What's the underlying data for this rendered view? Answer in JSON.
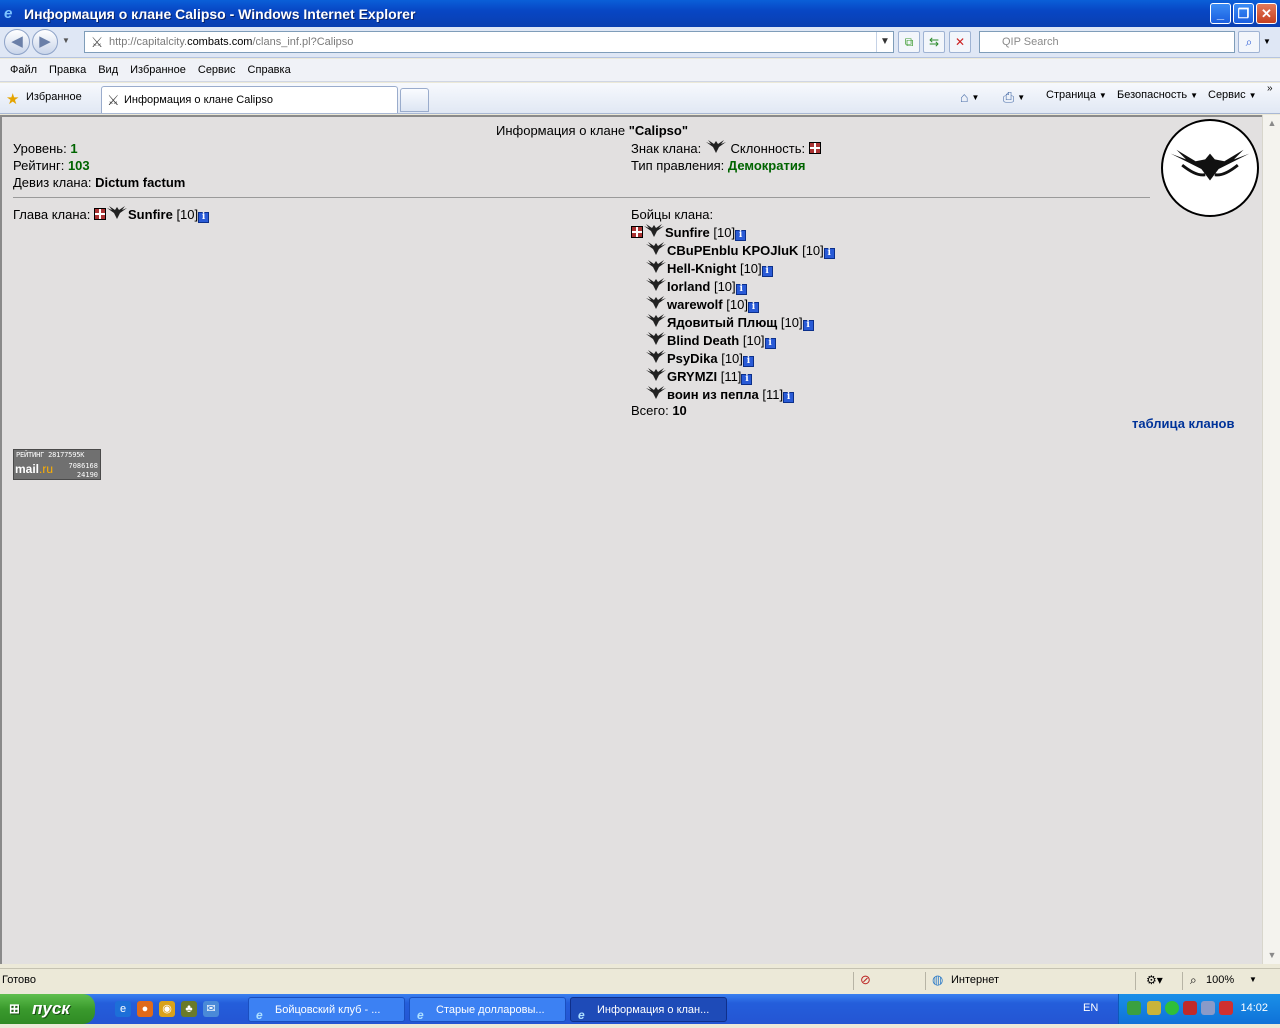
{
  "window": {
    "title": "Информация о клане Calipso - Windows Internet Explorer"
  },
  "address": {
    "url_prefix": "http://capitalcity.",
    "url_host": "combats.com",
    "url_path": "/clans_inf.pl?Calipso",
    "search_placeholder": "QIP Search"
  },
  "menu": [
    "Файл",
    "Правка",
    "Вид",
    "Избранное",
    "Сервис",
    "Справка"
  ],
  "favorites": {
    "label": "Избранное",
    "tab_title": "Информация о клане Calipso",
    "cmd_page": "Страница",
    "cmd_safety": "Безопасность",
    "cmd_tools": "Сервис"
  },
  "page": {
    "title_prefix": "Информация о клане ",
    "clan_name": "\"Calipso\"",
    "level_label": "Уровень: ",
    "level_value": "1",
    "rating_label": "Рейтинг: ",
    "rating_value": "103",
    "motto_label": "Девиз клана: ",
    "motto_value": "Dictum factum",
    "sign_label": "Знак клана: ",
    "alignment_label": "Склонность: ",
    "gov_label": "Тип правления: ",
    "gov_value": "Демократия",
    "head_label": "Глава клана: ",
    "head_name": "Sunfire",
    "head_level": "[10]",
    "members_label": "Бойцы клана:",
    "members": [
      {
        "name": "Sunfire",
        "level": "[10]"
      },
      {
        "name": "CBuPEnblu KPOJluK",
        "level": "[10]"
      },
      {
        "name": "Hell-Knight",
        "level": "[10]"
      },
      {
        "name": "Iorland",
        "level": "[10]"
      },
      {
        "name": "warewolf",
        "level": "[10]"
      },
      {
        "name": "Ядовитый Плющ",
        "level": "[10]"
      },
      {
        "name": "Blind Death",
        "level": "[10]"
      },
      {
        "name": "PsyDika",
        "level": "[10]"
      },
      {
        "name": "GRYMZI",
        "level": "[11]"
      },
      {
        "name": "воин из пепла",
        "level": "[11]"
      }
    ],
    "total_label": "Всего: ",
    "total_value": "10",
    "clans_table_link": "таблица кланов",
    "counter": {
      "rating": "РЕЙТИНГ 28177595К",
      "mail_a": "mail",
      "mail_b": ".ru",
      "n1": "7086168",
      "n2": "24190"
    }
  },
  "status": {
    "text": "Готово",
    "zone": "Интернет",
    "zoom": "100%"
  },
  "taskbar": {
    "start": "пуск",
    "tasks": [
      "Бойцовский клуб - ...",
      "Старые долларовы...",
      "Информация о клан..."
    ],
    "lang": "EN",
    "clock": "14:02"
  }
}
